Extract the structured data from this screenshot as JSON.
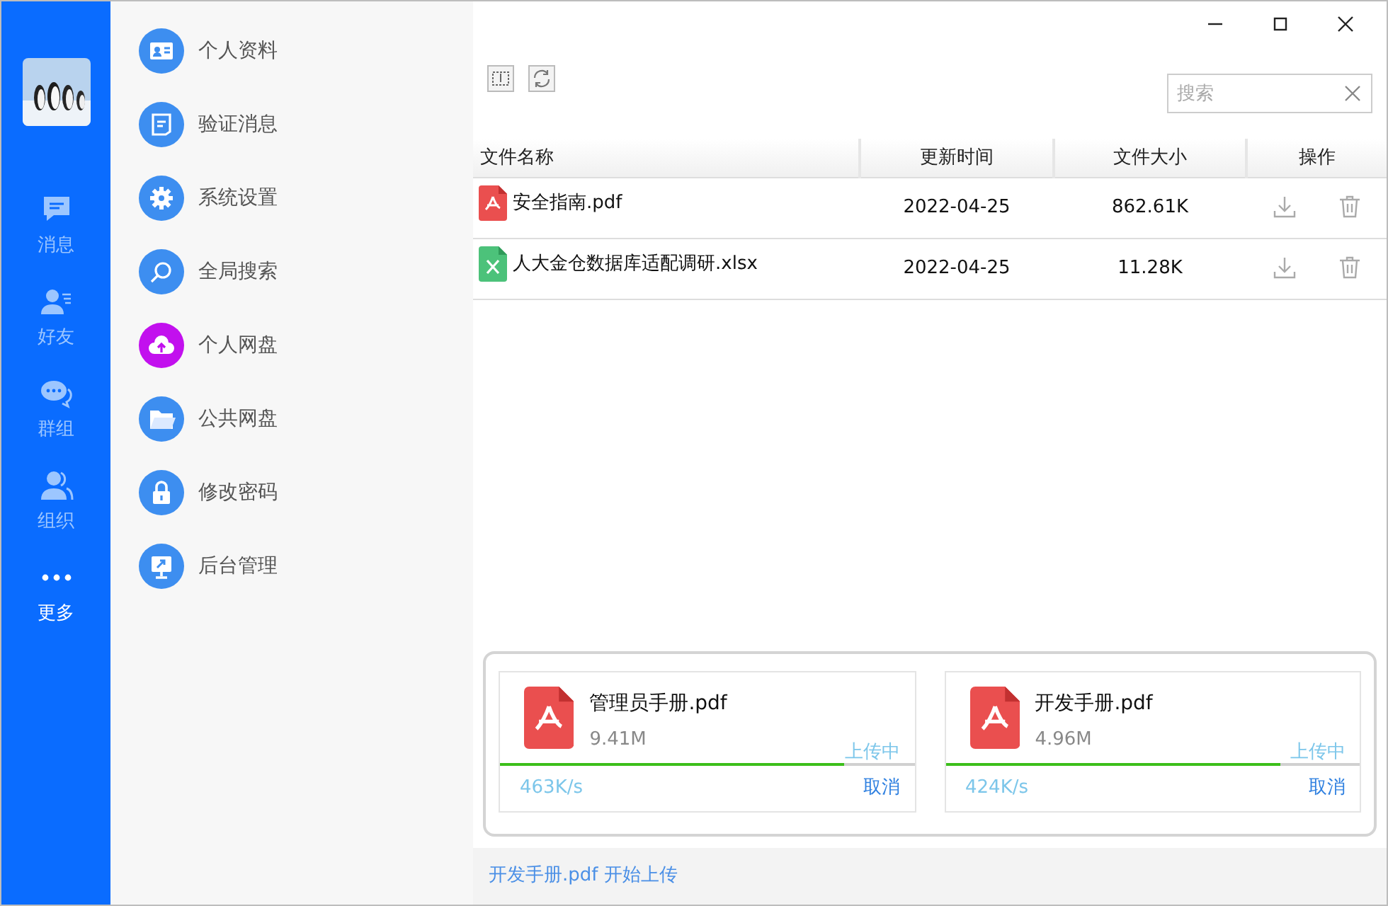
{
  "rail": {
    "items": [
      {
        "kind": "message",
        "label": "消息",
        "selected": false
      },
      {
        "kind": "friend",
        "label": "好友",
        "selected": false
      },
      {
        "kind": "group",
        "label": "群组",
        "selected": false
      },
      {
        "kind": "org",
        "label": "组织",
        "selected": false
      },
      {
        "kind": "more",
        "label": "更多",
        "selected": true
      }
    ]
  },
  "menu": {
    "items": [
      {
        "kind": "card",
        "label": "个人资料",
        "color": "#3d8ef0"
      },
      {
        "kind": "note",
        "label": "验证消息",
        "color": "#3d8ef0"
      },
      {
        "kind": "gear",
        "label": "系统设置",
        "color": "#3d8ef0"
      },
      {
        "kind": "search",
        "label": "全局搜索",
        "color": "#3d8ef0"
      },
      {
        "kind": "cloud",
        "label": "个人网盘",
        "color": "#c210ee"
      },
      {
        "kind": "folder",
        "label": "公共网盘",
        "color": "#3d8ef0"
      },
      {
        "kind": "lock",
        "label": "修改密码",
        "color": "#3d8ef0"
      },
      {
        "kind": "screen",
        "label": "后台管理",
        "color": "#3d8ef0"
      }
    ]
  },
  "search": {
    "placeholder": "搜索"
  },
  "table": {
    "columns": [
      "文件名称",
      "更新时间",
      "文件大小",
      "操作"
    ],
    "rows": [
      {
        "kind": "pdf",
        "name": "安全指南.pdf",
        "updated": "2022-04-25",
        "size": "862.61K"
      },
      {
        "kind": "xlsx",
        "name": "人大金仓数据库适配调研.xlsx",
        "updated": "2022-04-25",
        "size": "11.28K"
      }
    ]
  },
  "uploads": [
    {
      "kind": "pdf",
      "name": "管理员手册.pdf",
      "size": "9.41M",
      "status": "上传中",
      "level": 0.83,
      "speed": "463K/s",
      "cancel": "取消"
    },
    {
      "kind": "pdf",
      "name": "开发手册.pdf",
      "size": "4.96M",
      "status": "上传中",
      "level": 0.81,
      "speed": "424K/s",
      "cancel": "取消"
    }
  ],
  "status_bar": "开发手册.pdf 开始上传"
}
